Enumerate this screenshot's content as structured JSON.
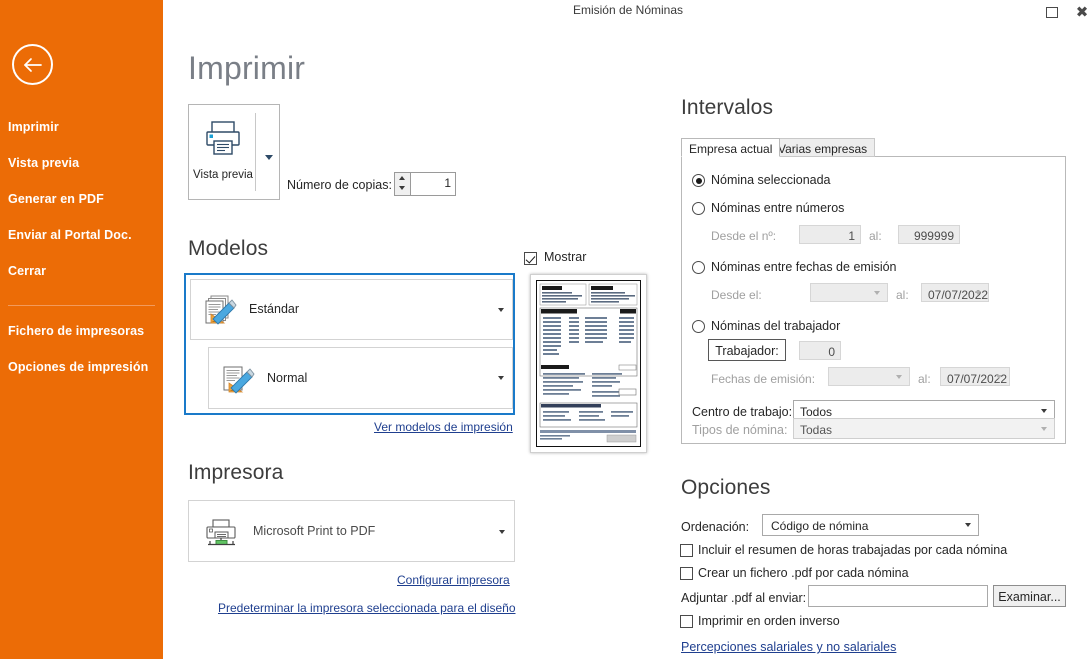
{
  "window": {
    "title": "Emisión de Nóminas",
    "restore_icon": "restore-icon",
    "close_icon": "close-icon"
  },
  "sidebar": {
    "back_icon": "back-arrow-icon",
    "items": [
      {
        "label": "Imprimir"
      },
      {
        "label": "Vista previa"
      },
      {
        "label": "Generar en PDF"
      },
      {
        "label": "Enviar al Portal Doc."
      },
      {
        "label": "Cerrar"
      }
    ],
    "items_secondary": [
      {
        "label": "Fichero de impresoras"
      },
      {
        "label": "Opciones de impresión"
      }
    ],
    "accent_color": "#ec6c06"
  },
  "main": {
    "page_title": "Imprimir",
    "preview_button": {
      "label": "Vista previa",
      "icon": "printer-icon",
      "dropdown_icon": "chevron-down-icon"
    },
    "copies": {
      "label": "Número de copias:",
      "value": "1",
      "up_icon": "spinner-up-icon",
      "down_icon": "spinner-down-icon"
    },
    "modelos": {
      "heading": "Modelos",
      "model_primary": {
        "value": "Estándar",
        "icon": "document-edit-icon"
      },
      "model_secondary": {
        "value": "Normal",
        "icon": "document-edit-icon"
      },
      "link": "Ver modelos de impresión",
      "selection_border_color": "#1a7ac9"
    },
    "preview_thumb": {
      "show_label": "Mostrar",
      "show_checked": true
    },
    "impresora": {
      "heading": "Impresora",
      "selected": "Microsoft Print to PDF",
      "icon": "printer-network-icon",
      "link_configure": "Configurar impresora",
      "link_default": "Predeterminar la impresora seleccionada para el diseño"
    }
  },
  "intervalos": {
    "heading": "Intervalos",
    "tabs": [
      {
        "label": "Empresa actual",
        "active": true
      },
      {
        "label": "Varias empresas",
        "active": false
      }
    ],
    "options": [
      {
        "label": "Nómina seleccionada",
        "selected": true
      },
      {
        "label": "Nóminas entre números",
        "selected": false
      },
      {
        "label": "Nóminas entre fechas de emisión",
        "selected": false
      },
      {
        "label": "Nóminas del trabajador",
        "selected": false
      }
    ],
    "numbers_row": {
      "from_label": "Desde el nº:",
      "from_value": "1",
      "to_label": "al:",
      "to_value": "999999"
    },
    "dates_row": {
      "from_label": "Desde el:",
      "from_value": "",
      "to_label": "al:",
      "to_value": "07/07/2022",
      "caret_icon": "chevron-down-icon"
    },
    "worker_row": {
      "button_label": "Trabajador:",
      "value": "0"
    },
    "worker_dates_row": {
      "label": "Fechas de emisión:",
      "from_value": "",
      "to_label": "al:",
      "to_value": "07/07/2022"
    },
    "centro": {
      "label": "Centro de trabajo:",
      "value": "Todos"
    },
    "tipos": {
      "label": "Tipos de nómina:",
      "value": "Todas"
    }
  },
  "opciones": {
    "heading": "Opciones",
    "orden": {
      "label": "Ordenación:",
      "value": "Código de nómina"
    },
    "checkboxes": [
      {
        "label": "Incluir el resumen de horas trabajadas por cada nómina",
        "checked": false
      },
      {
        "label": "Crear un fichero .pdf por cada nómina",
        "checked": false
      }
    ],
    "attach": {
      "label": "Adjuntar .pdf al enviar:",
      "value": "",
      "button": "Examinar..."
    },
    "reverse": {
      "label": "Imprimir en orden inverso",
      "checked": false
    },
    "link": "Percepciones salariales y no salariales"
  }
}
